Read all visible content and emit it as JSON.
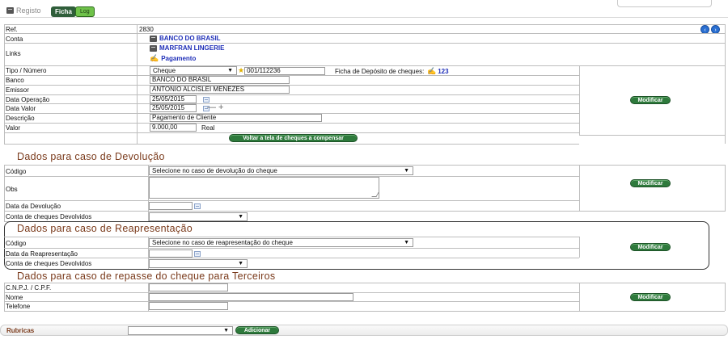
{
  "tabs": {
    "registo": "Registo",
    "ficha": "Ficha",
    "log": "Log"
  },
  "ficha": {
    "ref_label": "Ref.",
    "ref_value": "2830",
    "conta_label": "Conta",
    "conta_value": "BANCO DO BRASIL",
    "links_label": "Links",
    "links_item1": "MARFRAN LINGERIE",
    "links_item2": "Pagamento",
    "tipo_label": "Tipo / Número",
    "tipo_select": "Cheque",
    "numero_value": "001/112236",
    "deposito_label": "Ficha de Depósito de cheques:",
    "deposito_value": "123",
    "banco_label": "Banco",
    "banco_value": "BANCO DO BRASIL",
    "emissor_label": "Emissor",
    "emissor_value": "ANTONIO ALCISLEI MENEZES",
    "data_op_label": "Data Operação",
    "data_op_value": "25/05/2015",
    "data_valor_label": "Data Valor",
    "data_valor_value": "25/05/2015",
    "data_valor_adjust": "— +",
    "descricao_label": "Descrição",
    "descricao_value": "Pagamento de Cliente",
    "valor_label": "Valor",
    "valor_value": "9.000,00",
    "valor_currency": "Real",
    "voltar_button": "Voltar a tela de cheques a compensar",
    "modificar_button": "Modificar"
  },
  "devolucao": {
    "title": "Dados para caso de Devolução",
    "codigo_label": "Código",
    "codigo_select": "Selecione no caso de devolução do cheque",
    "obs_label": "Obs",
    "data_label": "Data da Devolução",
    "conta_label": "Conta de cheques Devolvidos",
    "modificar_button": "Modificar"
  },
  "reapresentacao": {
    "title": "Dados para caso de Reapresentação",
    "codigo_label": "Código",
    "codigo_select": "Selecione no caso de reapresentação do cheque",
    "data_label": "Data da Reapresentação",
    "conta_label": "Conta de cheques Devolvidos",
    "modificar_button": "Modificar"
  },
  "repasse": {
    "title": "Dados para caso de repasse do cheque para Terceiros",
    "cnpj_label": "C.N.P.J. / C.P.F.",
    "nome_label": "Nome",
    "telefone_label": "Telefone",
    "modificar_button": "Modificar"
  },
  "rubricas": {
    "label": "Rubricas",
    "adicionar_button": "Adicionar"
  },
  "colors": {
    "accent_green": "#2e7a3c",
    "section_brown": "#7a3a1b",
    "link_blue": "#1f2fb8"
  }
}
